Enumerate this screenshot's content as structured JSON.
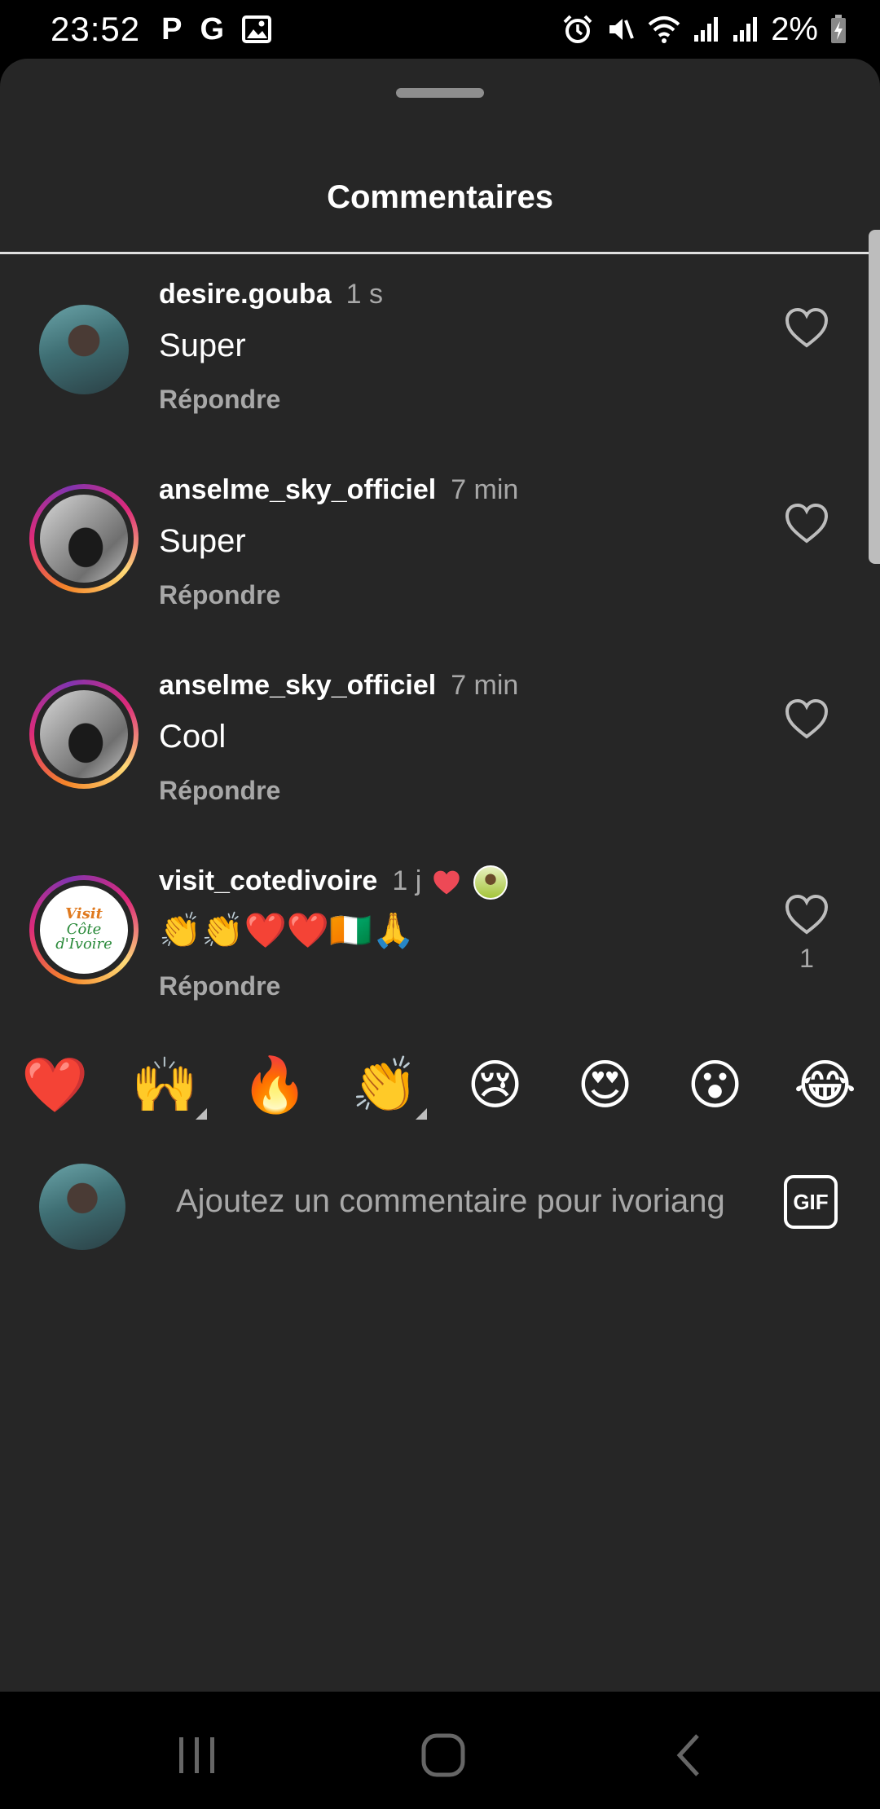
{
  "status_bar": {
    "time": "23:52",
    "left_icons": [
      "P",
      "G"
    ],
    "battery": "2%"
  },
  "sheet": {
    "title": "Commentaires"
  },
  "comments": [
    {
      "username": "desire.gouba",
      "time": "1 s",
      "text": "Super",
      "reply": "Répondre",
      "likes": ""
    },
    {
      "username": "anselme_sky_officiel",
      "time": "7 min",
      "text": "Super",
      "reply": "Répondre",
      "likes": ""
    },
    {
      "username": "anselme_sky_officiel",
      "time": "7 min",
      "text": "Cool",
      "reply": "Répondre",
      "likes": ""
    },
    {
      "username": "visit_cotedivoire",
      "time": "1 j",
      "text": "👏👏❤️❤️🇨🇮🙏",
      "reply": "Répondre",
      "likes": "1"
    }
  ],
  "avatar_logo": {
    "line1": "Visit",
    "line2": "Côte d'Ivoire"
  },
  "emoji_bar": [
    "❤️",
    "🙌",
    "🔥",
    "👏",
    "😢",
    "😍",
    "😮",
    "😂"
  ],
  "input": {
    "placeholder": "Ajoutez un commentaire pour ivoriang",
    "gif_label": "GIF"
  },
  "colors": {
    "background": "#262626",
    "secondary_text": "#a8a8a8",
    "like_red": "#ed4956"
  }
}
